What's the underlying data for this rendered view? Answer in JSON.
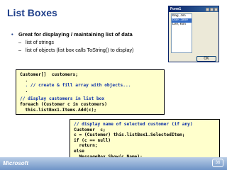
{
  "slide": {
    "title": "List Boxes",
    "bullet": "Great for displaying / maintaining list of data",
    "sub_bullets": [
      "list of strings",
      "list of objects (list box calls ToString() to display)"
    ],
    "brand": "Microsoft",
    "slide_number": "36"
  },
  "form": {
    "title": "Form1",
    "list_items": [
      "Bag, Jim",
      "Doe, Jane",
      "Lee, Kim"
    ],
    "selected_index": 1,
    "ok_label": "OK"
  },
  "code1": {
    "lines": [
      "Customer[]  customers;",
      "  .",
      "  . // create & fill array with objects...",
      "  .",
      "",
      "// display customers in list box",
      "foreach (Customer c in customers)",
      "  this.listBox1.Items.Add(c);"
    ]
  },
  "code2": {
    "lines": [
      "// display name of selected customer (if any)",
      "Customer  c;",
      "c = (Customer) this.listBox1.SelectedItem;",
      "if (c == null)",
      "  return;",
      "else",
      "  MessageBox.Show(c.Name);"
    ]
  },
  "colors": {
    "title": "#1f3f8a",
    "code_bg": "#ffffcc",
    "comment": "#0a2ea8"
  }
}
